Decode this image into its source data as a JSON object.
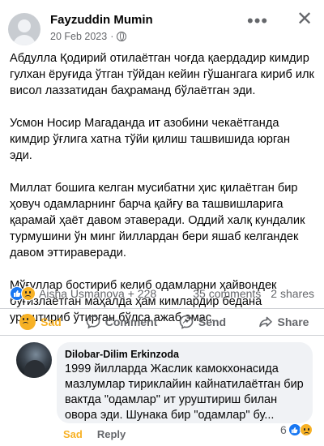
{
  "post": {
    "author": "Fayzuddin Mumin",
    "date": "20 Feb 2023",
    "date_separator": "·",
    "more_icon": "•••",
    "close_icon": "✕",
    "paragraphs": [
      "Абдулла Қодирий отилаётган чоғда қаердадир кимдир гулхан ёруғида ўтган тўйдан кейин гўшангага кириб илк висол лаззатидан баҳраманд бўлаётган эди.",
      "Усмон Носир Магаданда ит азобини чекаётганда кимдир ўғлига хатна тўйи қилиш ташвишида юрган эди.",
      "Миллат бошига келган мусибатни ҳис қилаётган бир ҳовуч одамларнинг барча қайғу ва ташвишларига қарамай ҳаёт давом этаверади. Оддий халқ кундалик турмушини ўн минг йиллардан бери яшаб келгандек давом эттираверади.",
      "Мўғуллар бостириб келиб одамларни ҳайвондек бўғизлаётган маҳалда ҳам кимлардир бедана уриштириб ўтирган бўлса ажаб эмас."
    ]
  },
  "reactions": {
    "summary": "Aisha Usmanova + 228",
    "comments": "35 comments",
    "shares": "2 shares"
  },
  "actions": {
    "sad": "Sad",
    "comment": "Comment",
    "send": "Send",
    "share": "Share"
  },
  "comment": {
    "author": "Dilobar-Dilim Erkinzoda",
    "text": "1999 йилларда Жаслик камокхонасида мазлумлар тириклайин кайнатилаётган бир вактда \"одамлар\" ит уруштириш билан овора эди. Шунака бир \"одамлар\" бу...",
    "reaction_count": "6",
    "sad_label": "Sad",
    "reply_label": "Reply"
  },
  "colors": {
    "accent": "#1877f2",
    "sad": "#f7b125",
    "muted": "#65676b"
  }
}
